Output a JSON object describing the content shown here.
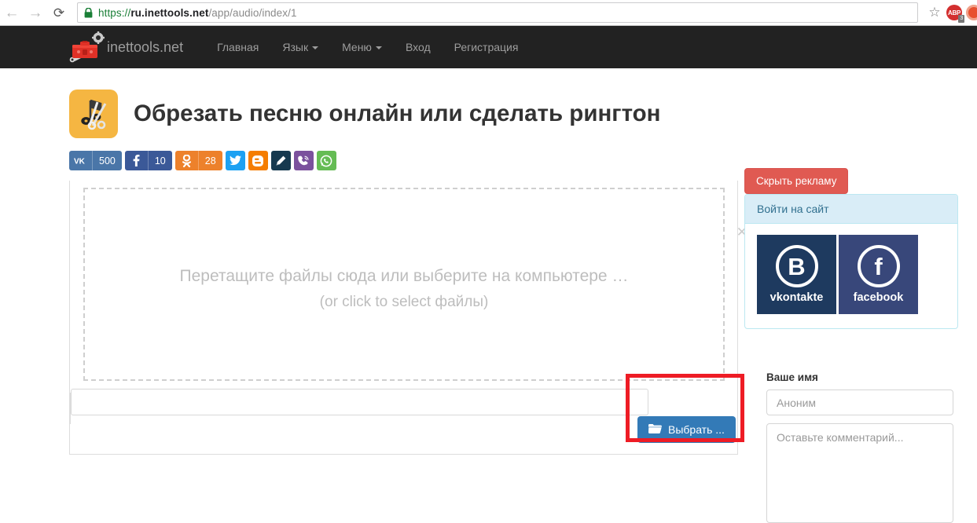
{
  "browser": {
    "back_icon": "back-arrow-icon",
    "forward_icon": "forward-arrow-icon",
    "reload_icon": "reload-icon",
    "reload_glyph": "⟳",
    "back_glyph": "←",
    "forward_glyph": "→",
    "star_glyph": "☆",
    "url": {
      "scheme": "https://",
      "host": "ru.inettools.net",
      "path": "/app/audio/index/1",
      "full": "https://ru.inettools.net/app/audio/index/1"
    },
    "extensions": [
      {
        "name": "adblock-plus",
        "label": "ABP",
        "badge": "3",
        "color": "#d32f2f"
      }
    ]
  },
  "site_nav": {
    "brand": "inettools.net",
    "brand_logo_icon": "toolbox-logo-icon",
    "links": [
      {
        "label": "Главная",
        "has_caret": false
      },
      {
        "label": "Язык",
        "has_caret": true
      },
      {
        "label": "Меню",
        "has_caret": true
      },
      {
        "label": "Вход",
        "has_caret": false
      },
      {
        "label": "Регистрация",
        "has_caret": false
      }
    ]
  },
  "page": {
    "title": "Обрезать песню онлайн или сделать рингтон",
    "title_icon": "scissors-music-note-icon"
  },
  "share_buttons": [
    {
      "name": "vkontakte",
      "glyph": "VK",
      "count": "500",
      "color": "#4a76a8"
    },
    {
      "name": "facebook",
      "glyph": "f",
      "count": "10",
      "color": "#3b5998"
    },
    {
      "name": "odnoklassniki",
      "glyph": "OK",
      "count": "28",
      "color": "#ed812b"
    },
    {
      "name": "twitter",
      "glyph": "🐦",
      "count": "",
      "color": "#1da1f2"
    },
    {
      "name": "blogger",
      "glyph": "B",
      "count": "",
      "color": "#f57d00"
    },
    {
      "name": "livejournal",
      "glyph": "✎",
      "count": "",
      "color": "#16394f"
    },
    {
      "name": "viber",
      "glyph": "✆",
      "count": "",
      "color": "#7b519d"
    },
    {
      "name": "whatsapp",
      "glyph": "✆",
      "count": "",
      "color": "#65bc54"
    }
  ],
  "uploader": {
    "dropzone_line1": "Перетащите файлы сюда или выберите на компьютере …",
    "dropzone_line2": "(or click to select файлы)",
    "close_glyph": "✕",
    "file_input_value": "",
    "choose_button_label": "Выбрать ...",
    "folder_icon": "folder-icon"
  },
  "annotation": {
    "color": "#ee1c25",
    "target": "choose-file-button"
  },
  "sidebar": {
    "hide_ads_label": "Скрыть рекламу",
    "hide_ads_color": "#e05a52",
    "login_panel": {
      "header": "Войти на сайт",
      "header_bg": "#d9edf7",
      "providers": [
        {
          "name": "vkontakte",
          "glyph": "В",
          "label": "vkontakte",
          "color": "#1e3a5f"
        },
        {
          "name": "facebook",
          "glyph": "f",
          "label": "facebook",
          "color": "#38477a"
        }
      ]
    },
    "comment_form": {
      "name_label": "Ваше имя",
      "name_placeholder": "Аноним",
      "name_value": "",
      "comment_placeholder": "Оставьте комментарий...",
      "comment_value": ""
    }
  }
}
